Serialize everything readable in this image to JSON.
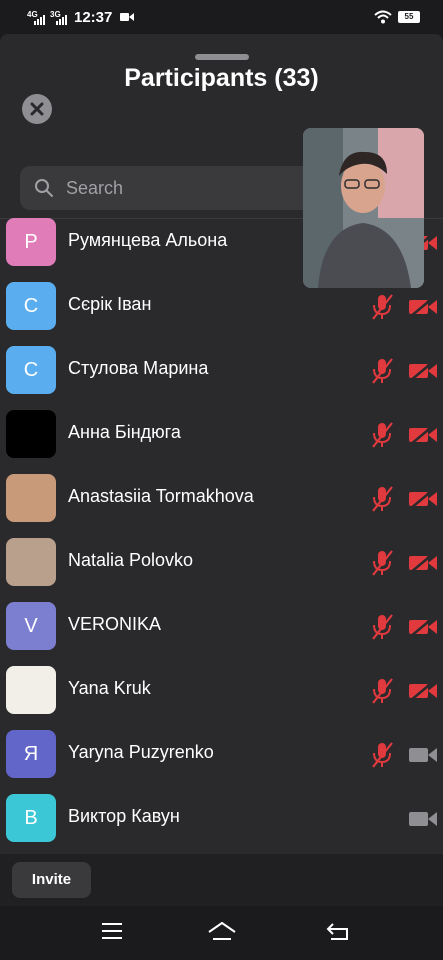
{
  "status_bar": {
    "network_1": "4G",
    "network_2": "3G",
    "time": "12:37",
    "battery": "55"
  },
  "sheet": {
    "title": "Participants (33)",
    "search_placeholder": "Search"
  },
  "participants": [
    {
      "name": "Румянцева Альона",
      "initial": "Р",
      "avatar_color": "#e07cb8",
      "mic_muted": true,
      "video_off": true
    },
    {
      "name": "Сєрік Іван",
      "initial": "С",
      "avatar_color": "#5aaef0",
      "mic_muted": true,
      "video_off": true
    },
    {
      "name": "Стулова Марина",
      "initial": "С",
      "avatar_color": "#5aaef0",
      "mic_muted": true,
      "video_off": true
    },
    {
      "name": "Анна Біндюга",
      "initial": "",
      "avatar_color": "#000000",
      "mic_muted": true,
      "video_off": true
    },
    {
      "name": "Anastasiia Tormakhova",
      "initial": "",
      "avatar_color": "#c99a7a",
      "mic_muted": true,
      "video_off": true
    },
    {
      "name": "Natalia Polovko",
      "initial": "",
      "avatar_color": "#b8a08c",
      "mic_muted": true,
      "video_off": true
    },
    {
      "name": "VERONIKA",
      "initial": "V",
      "avatar_color": "#7c7fd0",
      "mic_muted": true,
      "video_off": true
    },
    {
      "name": "Yana Kruk",
      "initial": "",
      "avatar_color": "#f2efe9",
      "mic_muted": true,
      "video_off": true
    },
    {
      "name": "Yaryna Puzyrenko",
      "initial": "Я",
      "avatar_color": "#6166c8",
      "mic_muted": true,
      "video_off": false
    },
    {
      "name": "Виктор Кавун",
      "initial": "В",
      "avatar_color": "#3cc7d6",
      "mic_muted": false,
      "video_off": false
    }
  ],
  "footer": {
    "invite_label": "Invite"
  },
  "colors": {
    "muted_red": "#e0393e",
    "icon_gray": "#8e8e93",
    "sheet_bg": "#2a2a2c"
  }
}
